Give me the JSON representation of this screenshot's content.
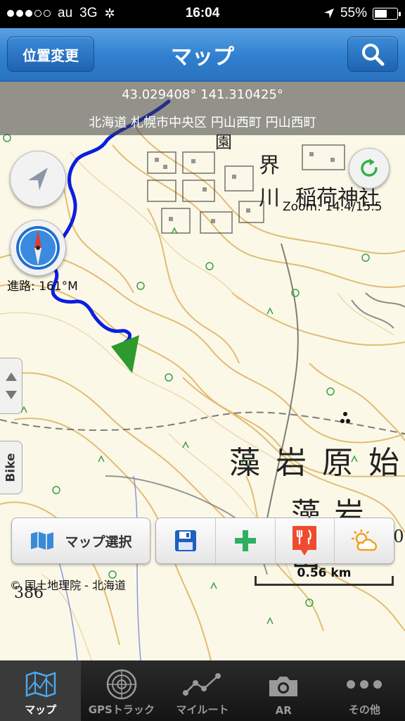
{
  "status_bar": {
    "carrier": "au",
    "network": "3G",
    "time": "16:04",
    "battery": "55%",
    "battery_level": 0.55
  },
  "nav": {
    "left_button": "位置変更",
    "title": "マップ",
    "search_icon": "search-icon"
  },
  "map": {
    "coordinates": "43.029408° 141.310425°",
    "address": "北海道 札幌市中央区 円山西町 円山西町",
    "zoom": "Zoom: 14.4/15.5",
    "heading": "進路: 161°M",
    "bike_tab": "Bike",
    "attribution": "© 国土地理院 - 北海道",
    "scale": "0.56 km",
    "map_text": {
      "place1": "藻 岩 原 始",
      "place2": "藻 岩 山",
      "num1": "30",
      "num2": "386",
      "k1": "界",
      "k2": "川",
      "k3": "稲荷神社",
      "k4": "園"
    },
    "colors": {
      "track": "#0a1ee0",
      "position_marker": "#2e9a2e",
      "contour": "#d9a84a"
    }
  },
  "toolbar": {
    "map_select": "マップ選択",
    "icons": [
      "save-icon",
      "add-icon",
      "restaurant-icon",
      "weather-icon"
    ]
  },
  "tabs": [
    {
      "label": "マップ",
      "icon": "map-icon",
      "active": true
    },
    {
      "label": "GPSトラック",
      "icon": "radar-icon",
      "active": false
    },
    {
      "label": "マイルート",
      "icon": "route-icon",
      "active": false
    },
    {
      "label": "AR",
      "icon": "camera-icon",
      "active": false
    },
    {
      "label": "その他",
      "icon": "more-icon",
      "active": false
    }
  ]
}
